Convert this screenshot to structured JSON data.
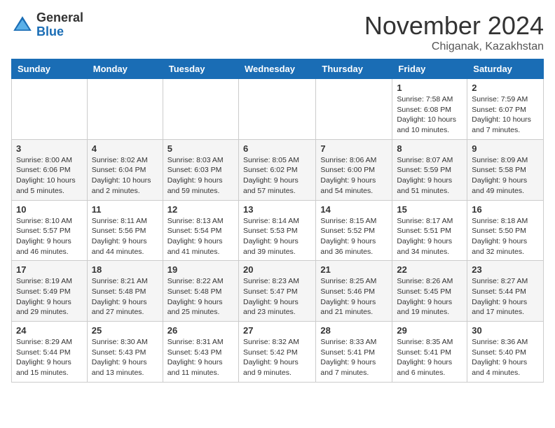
{
  "header": {
    "logo_general": "General",
    "logo_blue": "Blue",
    "month_title": "November 2024",
    "location": "Chiganak, Kazakhstan"
  },
  "weekdays": [
    "Sunday",
    "Monday",
    "Tuesday",
    "Wednesday",
    "Thursday",
    "Friday",
    "Saturday"
  ],
  "weeks": [
    [
      {
        "day": "",
        "info": ""
      },
      {
        "day": "",
        "info": ""
      },
      {
        "day": "",
        "info": ""
      },
      {
        "day": "",
        "info": ""
      },
      {
        "day": "",
        "info": ""
      },
      {
        "day": "1",
        "info": "Sunrise: 7:58 AM\nSunset: 6:08 PM\nDaylight: 10 hours\nand 10 minutes."
      },
      {
        "day": "2",
        "info": "Sunrise: 7:59 AM\nSunset: 6:07 PM\nDaylight: 10 hours\nand 7 minutes."
      }
    ],
    [
      {
        "day": "3",
        "info": "Sunrise: 8:00 AM\nSunset: 6:06 PM\nDaylight: 10 hours\nand 5 minutes."
      },
      {
        "day": "4",
        "info": "Sunrise: 8:02 AM\nSunset: 6:04 PM\nDaylight: 10 hours\nand 2 minutes."
      },
      {
        "day": "5",
        "info": "Sunrise: 8:03 AM\nSunset: 6:03 PM\nDaylight: 9 hours\nand 59 minutes."
      },
      {
        "day": "6",
        "info": "Sunrise: 8:05 AM\nSunset: 6:02 PM\nDaylight: 9 hours\nand 57 minutes."
      },
      {
        "day": "7",
        "info": "Sunrise: 8:06 AM\nSunset: 6:00 PM\nDaylight: 9 hours\nand 54 minutes."
      },
      {
        "day": "8",
        "info": "Sunrise: 8:07 AM\nSunset: 5:59 PM\nDaylight: 9 hours\nand 51 minutes."
      },
      {
        "day": "9",
        "info": "Sunrise: 8:09 AM\nSunset: 5:58 PM\nDaylight: 9 hours\nand 49 minutes."
      }
    ],
    [
      {
        "day": "10",
        "info": "Sunrise: 8:10 AM\nSunset: 5:57 PM\nDaylight: 9 hours\nand 46 minutes."
      },
      {
        "day": "11",
        "info": "Sunrise: 8:11 AM\nSunset: 5:56 PM\nDaylight: 9 hours\nand 44 minutes."
      },
      {
        "day": "12",
        "info": "Sunrise: 8:13 AM\nSunset: 5:54 PM\nDaylight: 9 hours\nand 41 minutes."
      },
      {
        "day": "13",
        "info": "Sunrise: 8:14 AM\nSunset: 5:53 PM\nDaylight: 9 hours\nand 39 minutes."
      },
      {
        "day": "14",
        "info": "Sunrise: 8:15 AM\nSunset: 5:52 PM\nDaylight: 9 hours\nand 36 minutes."
      },
      {
        "day": "15",
        "info": "Sunrise: 8:17 AM\nSunset: 5:51 PM\nDaylight: 9 hours\nand 34 minutes."
      },
      {
        "day": "16",
        "info": "Sunrise: 8:18 AM\nSunset: 5:50 PM\nDaylight: 9 hours\nand 32 minutes."
      }
    ],
    [
      {
        "day": "17",
        "info": "Sunrise: 8:19 AM\nSunset: 5:49 PM\nDaylight: 9 hours\nand 29 minutes."
      },
      {
        "day": "18",
        "info": "Sunrise: 8:21 AM\nSunset: 5:48 PM\nDaylight: 9 hours\nand 27 minutes."
      },
      {
        "day": "19",
        "info": "Sunrise: 8:22 AM\nSunset: 5:48 PM\nDaylight: 9 hours\nand 25 minutes."
      },
      {
        "day": "20",
        "info": "Sunrise: 8:23 AM\nSunset: 5:47 PM\nDaylight: 9 hours\nand 23 minutes."
      },
      {
        "day": "21",
        "info": "Sunrise: 8:25 AM\nSunset: 5:46 PM\nDaylight: 9 hours\nand 21 minutes."
      },
      {
        "day": "22",
        "info": "Sunrise: 8:26 AM\nSunset: 5:45 PM\nDaylight: 9 hours\nand 19 minutes."
      },
      {
        "day": "23",
        "info": "Sunrise: 8:27 AM\nSunset: 5:44 PM\nDaylight: 9 hours\nand 17 minutes."
      }
    ],
    [
      {
        "day": "24",
        "info": "Sunrise: 8:29 AM\nSunset: 5:44 PM\nDaylight: 9 hours\nand 15 minutes."
      },
      {
        "day": "25",
        "info": "Sunrise: 8:30 AM\nSunset: 5:43 PM\nDaylight: 9 hours\nand 13 minutes."
      },
      {
        "day": "26",
        "info": "Sunrise: 8:31 AM\nSunset: 5:43 PM\nDaylight: 9 hours\nand 11 minutes."
      },
      {
        "day": "27",
        "info": "Sunrise: 8:32 AM\nSunset: 5:42 PM\nDaylight: 9 hours\nand 9 minutes."
      },
      {
        "day": "28",
        "info": "Sunrise: 8:33 AM\nSunset: 5:41 PM\nDaylight: 9 hours\nand 7 minutes."
      },
      {
        "day": "29",
        "info": "Sunrise: 8:35 AM\nSunset: 5:41 PM\nDaylight: 9 hours\nand 6 minutes."
      },
      {
        "day": "30",
        "info": "Sunrise: 8:36 AM\nSunset: 5:40 PM\nDaylight: 9 hours\nand 4 minutes."
      }
    ]
  ]
}
